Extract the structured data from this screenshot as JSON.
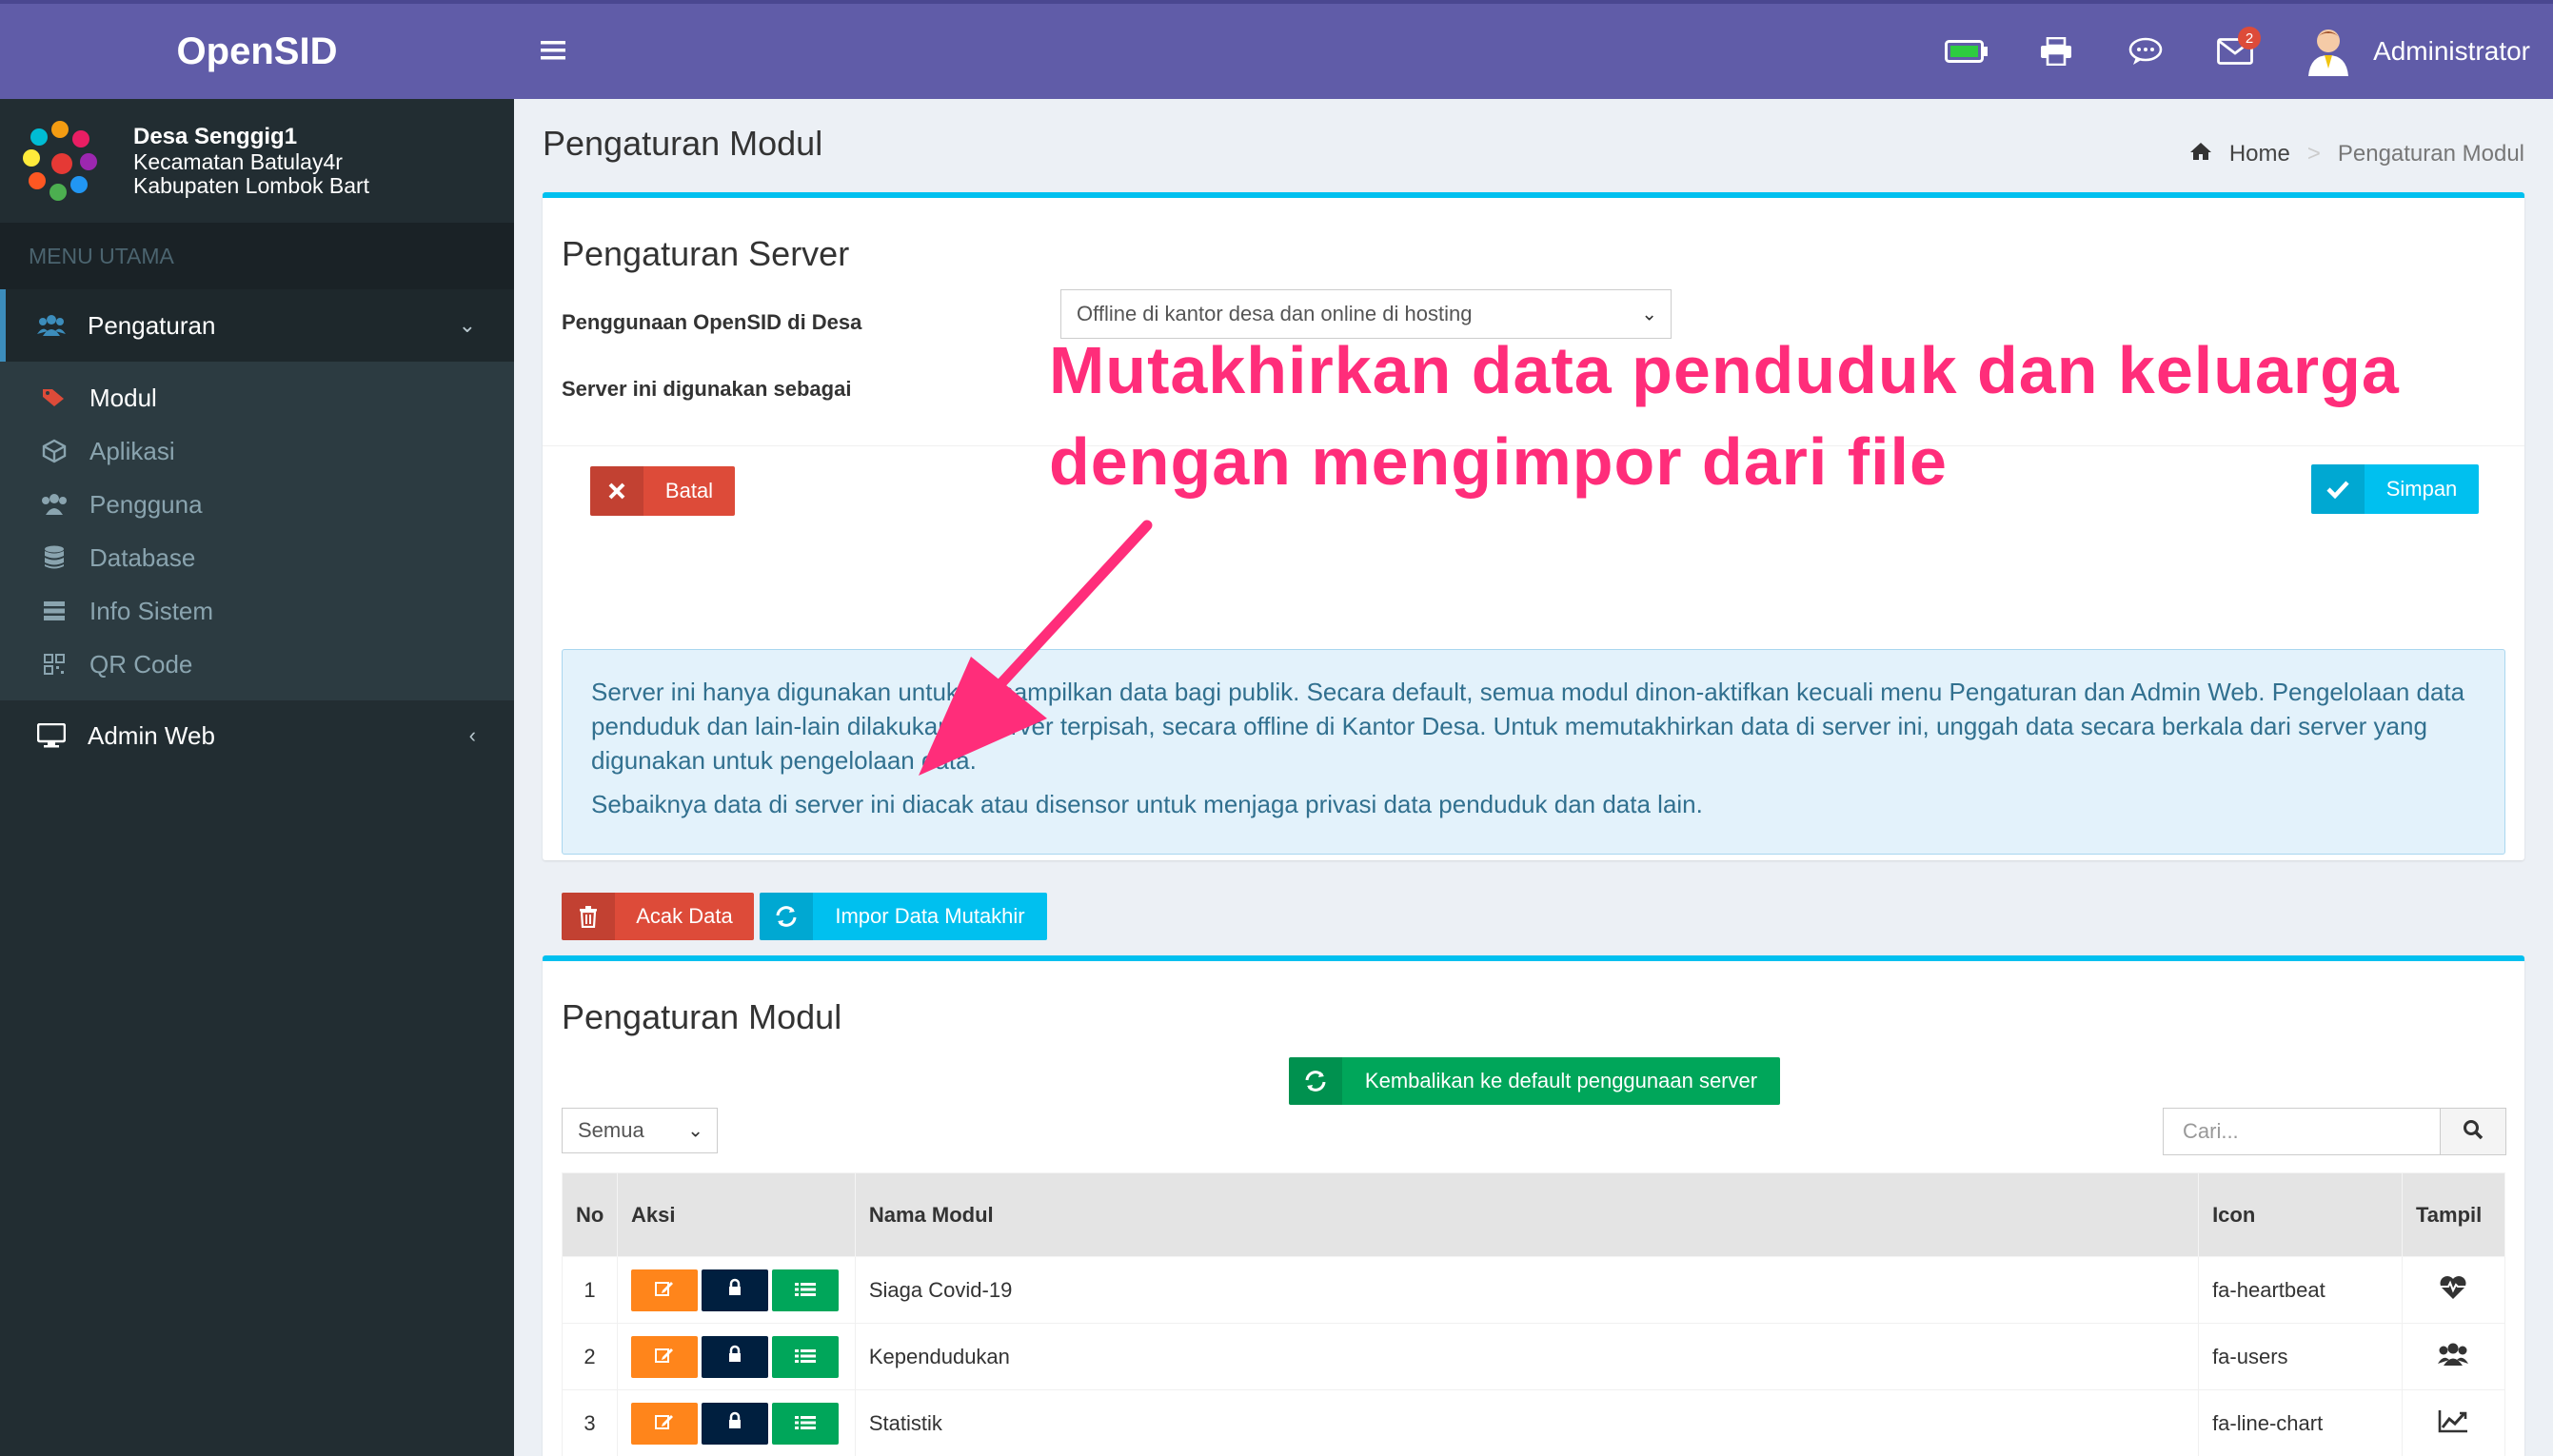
{
  "app": {
    "logo": "OpenSID"
  },
  "user_panel": {
    "name": "Desa Senggig1",
    "line1": "Kecamatan Batulay4r",
    "line2": "Kabupaten Lombok Bart"
  },
  "sidebar": {
    "header": "MENU UTAMA",
    "pengaturan": "Pengaturan",
    "sub": [
      "Modul",
      "Aplikasi",
      "Pengguna",
      "Database",
      "Info Sistem",
      "QR Code"
    ],
    "admin_web": "Admin Web"
  },
  "topbar": {
    "mail_badge": "2",
    "user": "Administrator"
  },
  "page": {
    "title": "Pengaturan Modul",
    "breadcrumb_home": "Home",
    "breadcrumb_current": "Pengaturan Modul"
  },
  "server": {
    "title": "Pengaturan Server",
    "label_usage": "Penggunaan OpenSID di Desa",
    "usage_value": "Offline di kantor desa dan online di hosting",
    "label_role": "Server ini digunakan sebagai",
    "cancel": "Batal",
    "save": "Simpan",
    "info1": "Server ini hanya digunakan untuk menampilkan data bagi publik. Secara default, semua modul dinon-aktifkan kecuali menu Pengaturan dan Admin Web. Pengelolaan data penduduk dan lain-lain dilakukan di server terpisah, secara offline di Kantor Desa. Untuk memutakhirkan data di server ini, unggah data secara berkala dari server yang digunakan untuk pengelolaan data.",
    "info2": "Sebaiknya data di server ini diacak atau disensor untuk menjaga privasi data penduduk dan data lain.",
    "acak": "Acak Data",
    "impor": "Impor Data Mutakhir"
  },
  "annotation": {
    "line1": "Mutakhirkan data penduduk dan keluarga",
    "line2": "dengan mengimpor dari file"
  },
  "modul": {
    "title": "Pengaturan Modul",
    "reset": "Kembalikan ke default penggunaan server",
    "filter": "Semua",
    "search_placeholder": "Cari...",
    "columns": {
      "no": "No",
      "aksi": "Aksi",
      "nama": "Nama Modul",
      "icon": "Icon",
      "tampil": "Tampil"
    },
    "rows": [
      {
        "no": "1",
        "nama": "Siaga Covid-19",
        "icon": "fa-heartbeat",
        "glyph": "heartbeat-icon"
      },
      {
        "no": "2",
        "nama": "Kependudukan",
        "icon": "fa-users",
        "glyph": "users-icon"
      },
      {
        "no": "3",
        "nama": "Statistik",
        "icon": "fa-line-chart",
        "glyph": "line-chart-icon"
      }
    ]
  },
  "colors": {
    "brand": "#605ca8",
    "sidebar": "#222d32",
    "info": "#00c0ef",
    "danger": "#dd4b39",
    "success": "#00a65a",
    "warning": "#ff851b",
    "navy": "#001f3f",
    "annotation": "#ff2d7a"
  }
}
